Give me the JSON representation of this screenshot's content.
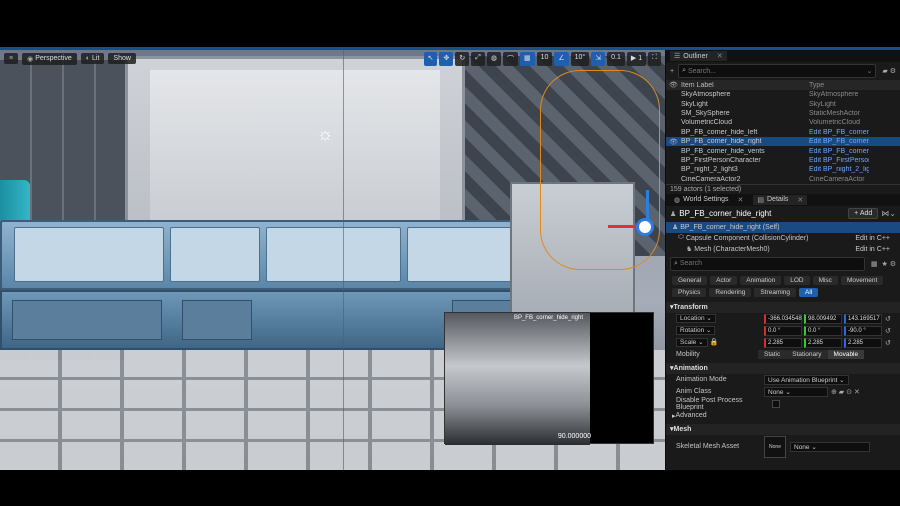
{
  "viewport": {
    "toolbar": {
      "menu_icon": "hamburger-icon",
      "perspective": "Perspective",
      "lit": "Lit",
      "show": "Show",
      "grid_snap": "10",
      "rot_snap": "10°",
      "scale_snap": "0.1",
      "cam_speed": "1"
    },
    "preview": {
      "camera_label": "BP_FB_corner_hide_right",
      "fov": "90.000000"
    }
  },
  "outliner": {
    "tab": "Outliner",
    "search_placeholder": "Search...",
    "col_label": "Item Label",
    "col_type": "Type",
    "rows": [
      {
        "label": "SkyAtmosphere",
        "type": "SkyAtmosphere",
        "link": false,
        "sel": false,
        "eye": false
      },
      {
        "label": "SkyLight",
        "type": "SkyLight",
        "link": false,
        "sel": false,
        "eye": false
      },
      {
        "label": "SM_SkySphere",
        "type": "StaticMeshActor",
        "link": false,
        "sel": false,
        "eye": false
      },
      {
        "label": "VolumetricCloud",
        "type": "VolumetricCloud",
        "link": false,
        "sel": false,
        "eye": false
      },
      {
        "label": "BP_FB_corner_hide_left",
        "type": "Edit BP_FB_corner_hi",
        "link": true,
        "sel": false,
        "eye": true
      },
      {
        "label": "BP_FB_corner_hide_right",
        "type": "Edit BP_FB_corner_hi",
        "link": true,
        "sel": true,
        "eye": true
      },
      {
        "label": "BP_FB_corner_hide_vents",
        "type": "Edit BP_FB_corner_hi",
        "link": true,
        "sel": false,
        "eye": true
      },
      {
        "label": "BP_FirstPersonCharacter",
        "type": "Edit BP_FirstPersonC",
        "link": true,
        "sel": false,
        "eye": true
      },
      {
        "label": "BP_night_2_light3",
        "type": "Edit BP_night_2_light",
        "link": true,
        "sel": false,
        "eye": true
      },
      {
        "label": "CineCameraActor2",
        "type": "CineCameraActor",
        "link": false,
        "sel": false,
        "eye": true
      }
    ],
    "count": "159 actors (1 selected)"
  },
  "details": {
    "tabs": [
      "World Settings",
      "Details"
    ],
    "actor_name": "BP_FB_corner_hide_right",
    "add_label": "Add",
    "components": [
      {
        "label": "BP_FB_corner_hide_right (Self)",
        "link": "",
        "sel": true
      },
      {
        "label": "Capsule Component (CollisionCylinder)",
        "link": "Edit in C++",
        "sel": false
      },
      {
        "label": "Mesh (CharacterMesh0)",
        "link": "Edit in C++",
        "sel": false
      }
    ],
    "search_placeholder": "Search",
    "filters_row1": [
      "General",
      "Actor",
      "Animation",
      "LOD",
      "Misc",
      "Movement"
    ],
    "filters_row2": [
      "Physics",
      "Rendering",
      "Streaming",
      "All"
    ],
    "active_filter": "All",
    "transform": {
      "section": "Transform",
      "location_label": "Location",
      "location": [
        "-366.034548",
        "98.009492",
        "143.169517"
      ],
      "rotation_label": "Rotation",
      "rotation": [
        "0.0 °",
        "0.0 °",
        "-90.0 °"
      ],
      "scale_label": "Scale",
      "scale": [
        "2.285",
        "2.285",
        "2.285"
      ],
      "mobility_label": "Mobility",
      "mobility": [
        "Static",
        "Stationary",
        "Movable"
      ],
      "mobility_active": "Movable"
    },
    "animation": {
      "section": "Animation",
      "mode_label": "Animation Mode",
      "mode_value": "Use Animation Blueprint",
      "class_label": "Anim Class",
      "class_value": "None",
      "disable_label": "Disable Post Process Blueprint",
      "advanced": "Advanced"
    },
    "mesh": {
      "section": "Mesh",
      "asset_label": "Skeletal Mesh Asset",
      "asset_value": "None",
      "thumb": "None"
    }
  }
}
